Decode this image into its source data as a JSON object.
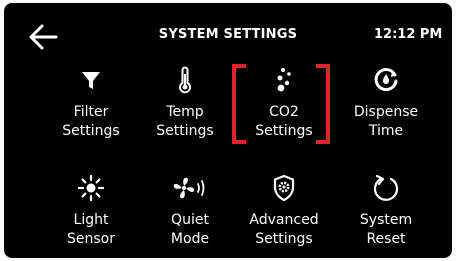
{
  "header": {
    "title": "SYSTEM SETTINGS",
    "time": "12:12 PM",
    "back_icon": "arrow-left-icon"
  },
  "tiles": [
    {
      "line1": "Filter",
      "line2": "Settings",
      "icon": "filter-icon"
    },
    {
      "line1": "Temp",
      "line2": "Settings",
      "icon": "thermometer-icon"
    },
    {
      "line1": "CO2",
      "line2": "Settings",
      "icon": "co2-bubbles-icon",
      "selected": true
    },
    {
      "line1": "Dispense",
      "line2": "Time",
      "icon": "dispense-timer-icon"
    },
    {
      "line1": "Light",
      "line2": "Sensor",
      "icon": "light-sensor-icon"
    },
    {
      "line1": "Quiet",
      "line2": "Mode",
      "icon": "quiet-fan-icon"
    },
    {
      "line1": "Advanced",
      "line2": "Settings",
      "icon": "shield-gear-icon"
    },
    {
      "line1": "System",
      "line2": "Reset",
      "icon": "reset-icon"
    }
  ],
  "colors": {
    "background": "#000000",
    "text": "#ffffff",
    "highlight": "#e0232b"
  }
}
